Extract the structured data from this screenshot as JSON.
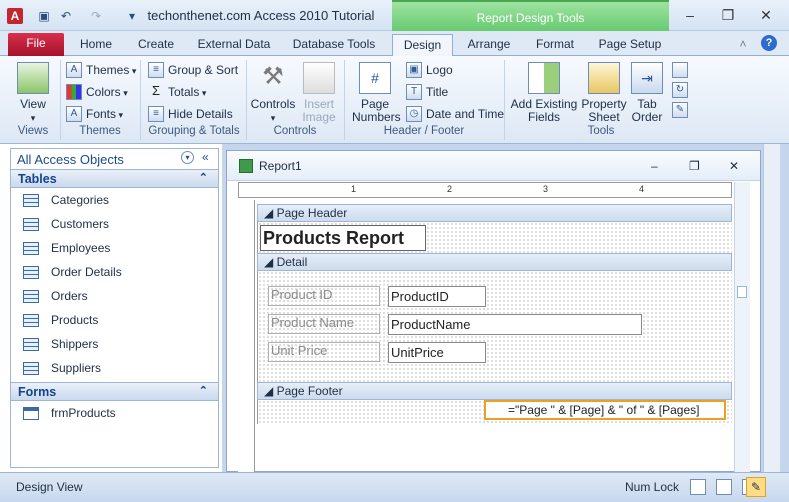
{
  "window": {
    "title": "techonthenet.com Access 2010 Tutorial",
    "context_tab": "Report Design Tools"
  },
  "tabs": [
    "File",
    "Home",
    "Create",
    "External Data",
    "Database Tools",
    "Design",
    "Arrange",
    "Format",
    "Page Setup"
  ],
  "ribbon": {
    "views": {
      "view": "View",
      "group": "Views"
    },
    "themes": {
      "themes": "Themes",
      "colors": "Colors",
      "fonts": "Fonts",
      "group": "Themes"
    },
    "grouping": {
      "group_sort": "Group & Sort",
      "totals": "Totals",
      "hide_details": "Hide Details",
      "group": "Grouping & Totals"
    },
    "controls": {
      "controls": "Controls",
      "insert_image": "Insert Image",
      "group": "Controls"
    },
    "header_footer": {
      "page_numbers": "Page Numbers",
      "logo": "Logo",
      "title": "Title",
      "date_time": "Date and Time",
      "group": "Header / Footer"
    },
    "tools": {
      "add_fields": "Add Existing Fields",
      "property_sheet": "Property Sheet",
      "tab_order": "Tab Order",
      "group": "Tools"
    }
  },
  "nav": {
    "header": "All Access Objects",
    "tables_header": "Tables",
    "tables": [
      "Categories",
      "Customers",
      "Employees",
      "Order Details",
      "Orders",
      "Products",
      "Shippers",
      "Suppliers"
    ],
    "forms_header": "Forms",
    "forms": [
      "frmProducts"
    ]
  },
  "report": {
    "title": "Report1",
    "ruler": [
      "1",
      "2",
      "3",
      "4"
    ],
    "page_header": "Page Header",
    "report_title": "Products Report",
    "detail": "Detail",
    "fields": [
      {
        "label": "Product ID",
        "value": "ProductID"
      },
      {
        "label": "Product Name",
        "value": "ProductName"
      },
      {
        "label": "Unit Price",
        "value": "UnitPrice"
      }
    ],
    "page_footer": "Page Footer",
    "footer_expr": "=\"Page \" & [Page] & \" of \" & [Pages]"
  },
  "status": {
    "left": "Design View",
    "num_lock": "Num Lock"
  }
}
